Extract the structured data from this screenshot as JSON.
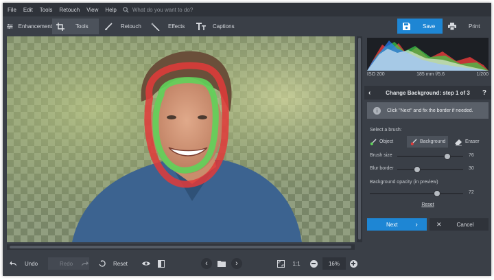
{
  "menu": {
    "items": [
      "File",
      "Edit",
      "Tools",
      "Retouch",
      "View",
      "Help"
    ],
    "search_placeholder": "What do you want to do?"
  },
  "toolbar": {
    "tabs": [
      {
        "label": "Enhancement",
        "icon": "sliders-icon"
      },
      {
        "label": "Tools",
        "icon": "crop-icon",
        "active": true
      },
      {
        "label": "Retouch",
        "icon": "brush-icon"
      },
      {
        "label": "Effects",
        "icon": "magic-wand-icon"
      },
      {
        "label": "Captions",
        "icon": "text-icon"
      }
    ],
    "save_label": "Save",
    "print_label": "Print"
  },
  "histogram": {
    "iso": "ISO 200",
    "lens": "185 mm f/5.6",
    "shutter": "1/200"
  },
  "panel": {
    "title": "Change Background: step 1 of 3",
    "info_text": "Click \"Next\" and fix the border if needed.",
    "brush_label": "Select a brush:",
    "brushes": [
      {
        "label": "Object",
        "selected": false
      },
      {
        "label": "Background",
        "selected": true
      },
      {
        "label": "Eraser",
        "selected": false
      }
    ],
    "sliders": [
      {
        "label": "Brush size",
        "value": 76,
        "fraction": 0.76
      },
      {
        "label": "Blur border",
        "value": 30,
        "fraction": 0.3
      },
      {
        "label": "Background opacity (in preview)",
        "value": 72,
        "fraction": 0.72
      }
    ],
    "reset_label": "Reset",
    "next_label": "Next",
    "cancel_label": "Cancel"
  },
  "bottom": {
    "undo_label": "Undo",
    "redo_label": "Redo",
    "reset_label": "Reset",
    "one_to_one_label": "1:1",
    "zoom_value": "16%"
  },
  "colors": {
    "accent": "#1e86d4",
    "object_stroke": "#5fd35a",
    "background_stroke": "#e23a3a"
  }
}
